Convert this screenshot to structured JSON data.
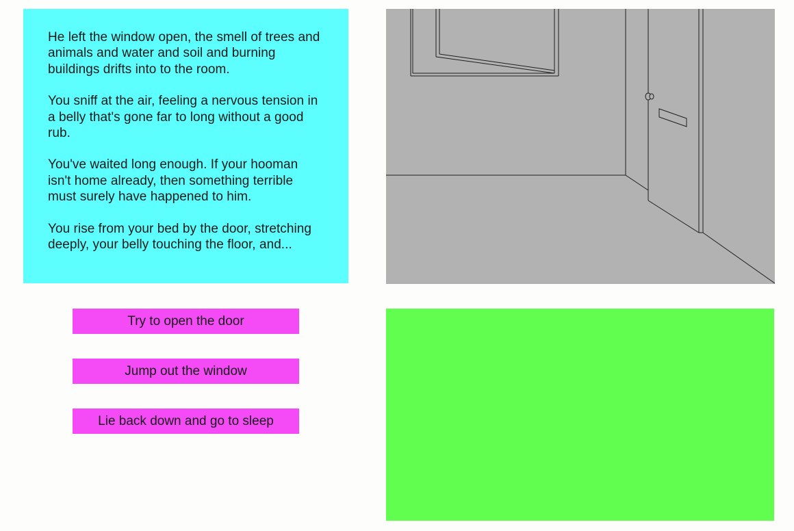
{
  "story": {
    "paragraphs": [
      "He left the window open, the smell of trees and animals and water and soil and burning buildings drifts into to the room.",
      "You sniff at the air, feeling a nervous tension in a belly that's gone far to long without a good rub.",
      "You've waited long enough. If your hooman isn't home already, then something terrible must surely have happened to him.",
      "You rise from your bed by the door, stretching deeply, your belly touching the floor, and..."
    ]
  },
  "choices": [
    "Try to open the door",
    "Jump out the window",
    "Lie back down and go to sleep"
  ],
  "scene": {
    "depicts": [
      "room-corner",
      "open-window",
      "door",
      "door-knob",
      "mail-slot"
    ]
  },
  "colors": {
    "story_panel": "#5cfefe",
    "choice_button": "#f54bf6",
    "scene_background": "#b2b2b2",
    "empty_panel": "#62fe4f",
    "page_background": "#fdfdfb"
  }
}
